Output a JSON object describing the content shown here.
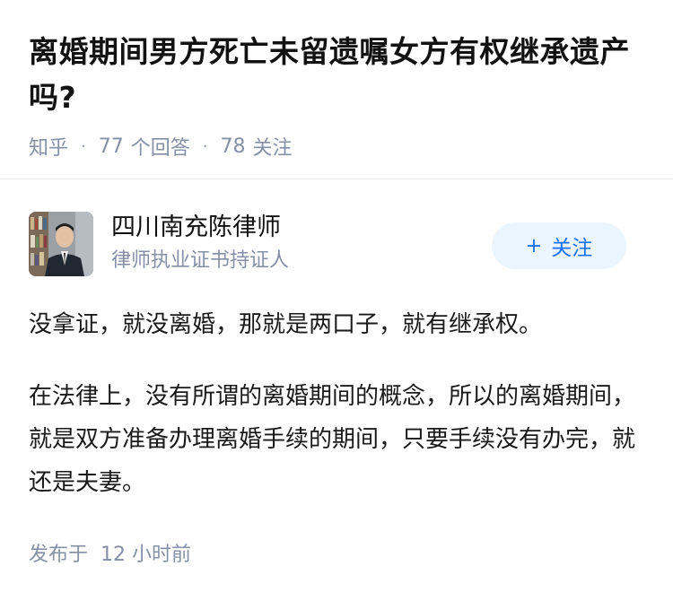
{
  "question": {
    "title": "离婚期间男方死亡未留遗嘱女方有权继承遗产吗?",
    "source": "知乎",
    "answer_count": "77",
    "answer_label": "个回答",
    "follower_count": "78",
    "follower_label": "关注"
  },
  "answer": {
    "author": {
      "name": "四川南充陈律师",
      "description": "律师执业证书持证人",
      "follow_label": "关注"
    },
    "paragraphs": [
      "没拿证，就没离婚，那就是两口子，就有继承权。",
      "在法律上，没有所谓的离婚期间的概念，所以的离婚期间，就是双方准备办理离婚手续的期间，只要手续没有办完，就还是夫妻。"
    ],
    "published": {
      "label": "发布于",
      "value": "12 小时前"
    }
  },
  "colors": {
    "meta_text": "#8590a6",
    "accent": "#1772f6",
    "follow_bg": "#ebf5ff"
  }
}
